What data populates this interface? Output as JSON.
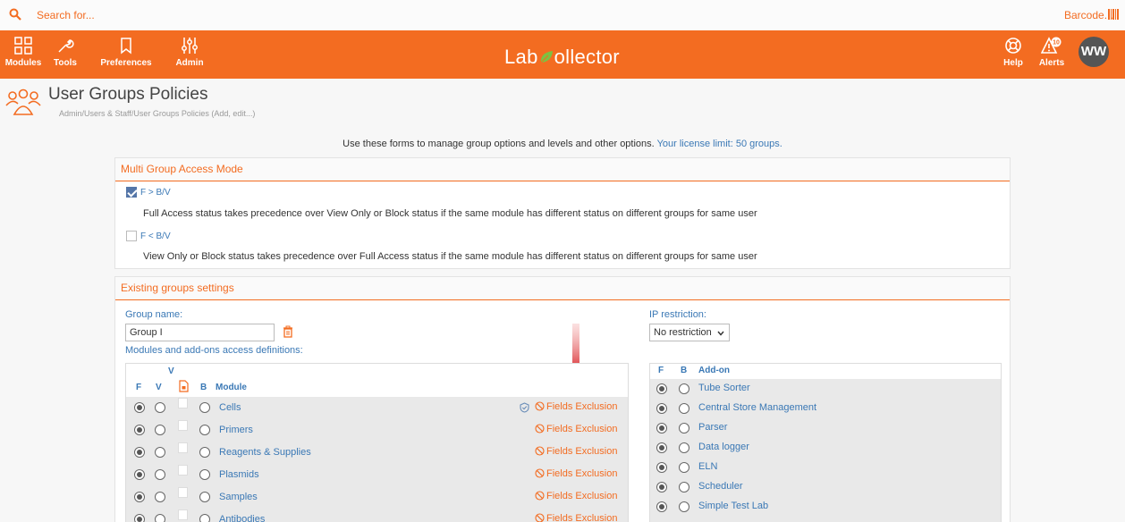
{
  "search": {
    "placeholder": "Search for..."
  },
  "barcode": {
    "label": "Barcode..."
  },
  "nav": {
    "modules": "Modules",
    "tools": "Tools",
    "preferences": "Preferences",
    "admin": "Admin",
    "help": "Help",
    "alerts": "Alerts",
    "alerts_count": "10",
    "avatar": "WW"
  },
  "logo": {
    "part1": "Lab",
    "part2": "ollector"
  },
  "page": {
    "title": "User Groups Policies",
    "breadcrumb": "Admin/Users & Staff/User Groups Policies (Add, edit...)",
    "info": "Use these forms to manage group options and levels and other options.",
    "license": "Your license limit: 50 groups."
  },
  "multi_access": {
    "heading": "Multi Group Access Mode",
    "opt1_label": "F > B/V",
    "opt1_desc": "Full Access status takes precedence over View Only or Block status if the same module has different status on different groups for same user",
    "opt2_label": "F < B/V",
    "opt2_desc": "View Only or Block status takes precedence over Full Access status if the same module has different status on different groups for same user"
  },
  "groups": {
    "heading": "Existing groups settings",
    "group_name_label": "Group name:",
    "group_name_value": "Group I",
    "modules_label": "Modules and add-ons access definitions:",
    "ip_label": "IP restriction:",
    "ip_value": "No restriction"
  },
  "modules_table": {
    "headers": {
      "v_top": "V",
      "f": "F",
      "v": "V",
      "b": "B",
      "module": "Module"
    },
    "fields_exclusion": "Fields Exclusion",
    "rows": [
      {
        "name": "Cells"
      },
      {
        "name": "Primers"
      },
      {
        "name": "Reagents & Supplies"
      },
      {
        "name": "Plasmids"
      },
      {
        "name": "Samples"
      },
      {
        "name": "Antibodies"
      }
    ]
  },
  "addons_table": {
    "headers": {
      "f": "F",
      "b": "B",
      "addon": "Add-on"
    },
    "rows": [
      {
        "name": "Tube Sorter"
      },
      {
        "name": "Central Store Management"
      },
      {
        "name": "Parser"
      },
      {
        "name": "Data logger"
      },
      {
        "name": "ELN"
      },
      {
        "name": "Scheduler"
      },
      {
        "name": "Simple Test Lab"
      }
    ]
  },
  "colors": {
    "accent": "#f36c21",
    "link": "#3a78b5"
  }
}
